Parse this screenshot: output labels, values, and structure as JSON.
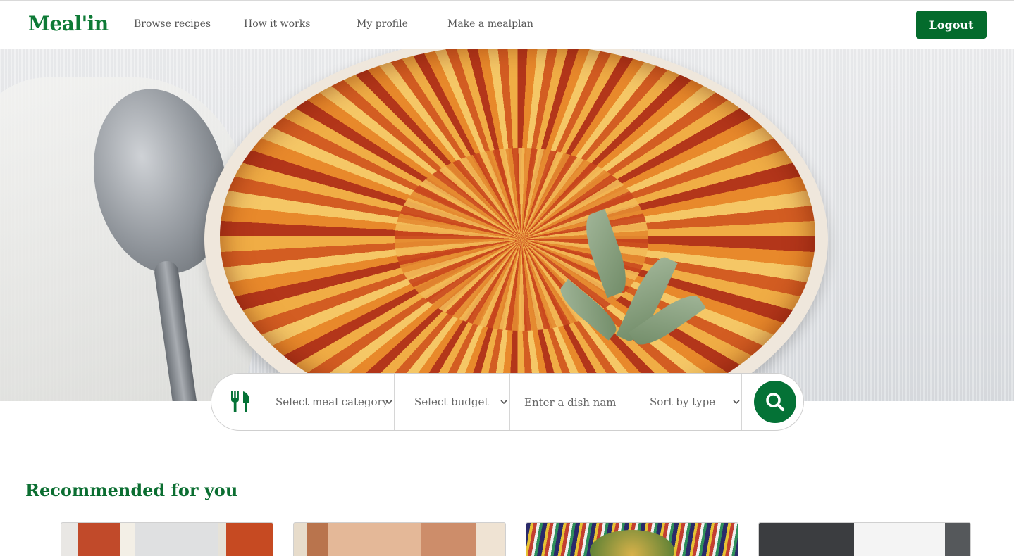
{
  "brand": {
    "logo": "Meal'in",
    "accent_color": "#047236"
  },
  "nav": {
    "links": [
      "Browse recipes",
      "How it works",
      "My profile",
      "Make a mealplan"
    ],
    "logout_label": "Logout"
  },
  "hero": {
    "image": "potato-gratin-hero-photo"
  },
  "search": {
    "category": {
      "selected": "Select meal category",
      "icon": "fork-knife-icon"
    },
    "budget": {
      "selected": "Select budget"
    },
    "dish": {
      "placeholder": "Enter a dish name",
      "value": ""
    },
    "sort": {
      "selected": "Sort by type"
    },
    "button_icon": "search-icon"
  },
  "recommended": {
    "title": "Recommended for you",
    "cards": [
      {
        "image": "lasagna-photo"
      },
      {
        "image": "baked-dish-photo"
      },
      {
        "image": "salad-photo"
      },
      {
        "image": "plated-dish-photo"
      }
    ]
  }
}
